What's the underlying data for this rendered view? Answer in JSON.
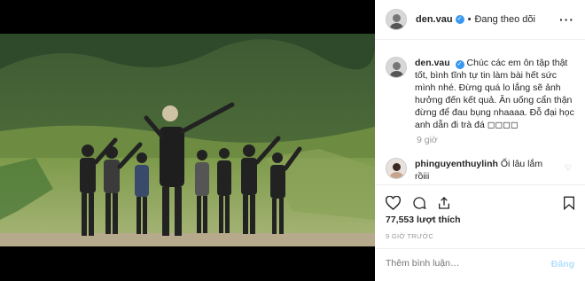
{
  "post": {
    "header": {
      "username": "den.vau",
      "verified_glyph": "✓",
      "separator": "•",
      "follow_status": "Đang theo dõi",
      "more_label": "···"
    },
    "caption": {
      "username": "den.vau",
      "text": "Chúc các em ôn tập thật tốt, bình tĩnh tự tin làm bài hết sức mình nhé. Đừng quá lo lắng sẽ ảnh hưởng đến kết quả. Ăn uống cẩn thận đừng để đau bụng nhaaaa. Đỗ đại học anh dẫn đi trà đá ◻◻◻◻",
      "time": "9 giờ"
    },
    "comment": {
      "username": "phinguyenthuylinh",
      "text": "Ối lâu lắm rồiii"
    },
    "actions": {
      "like_icon": "heart-icon",
      "comment_icon": "comment-icon",
      "share_icon": "share-icon",
      "save_icon": "bookmark-icon"
    },
    "likes": {
      "count": "77,553",
      "label": "lượt thích"
    },
    "timestamp": "9 GIỜ TRƯỚC",
    "add_comment": {
      "placeholder": "Thêm bình luận…",
      "post_label": "Đăng"
    }
  },
  "colors": {
    "verified": "#3897f0",
    "muted": "#999999",
    "post_disabled": "#b2dffc"
  }
}
